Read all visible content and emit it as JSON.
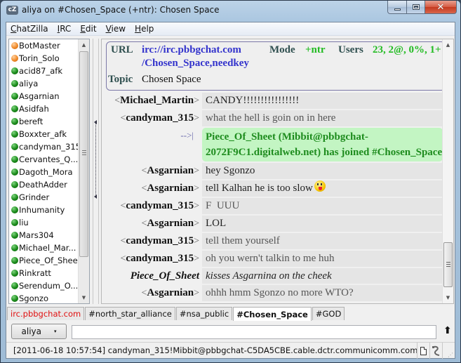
{
  "window": {
    "title": "aliya on #Chosen_Space (+ntr): Chosen Space",
    "app_icon": "cZ",
    "controls": {
      "minimize": "minimize",
      "maximize": "maximize",
      "close": "✕"
    }
  },
  "menubar": {
    "items": [
      {
        "label": "ChatZilla",
        "accel": "C",
        "rest": "hatZilla"
      },
      {
        "label": "IRC",
        "accel": "I",
        "rest": "RC"
      },
      {
        "label": "Edit",
        "accel": "E",
        "rest": "dit"
      },
      {
        "label": "View",
        "accel": "V",
        "rest": "iew"
      },
      {
        "label": "Help",
        "accel": "H",
        "rest": "elp"
      }
    ]
  },
  "userlist": {
    "users": [
      {
        "nick": "BotMaster",
        "status": "op"
      },
      {
        "nick": "Torin_Solo",
        "status": "op"
      },
      {
        "nick": "acid87_afk",
        "status": "normal"
      },
      {
        "nick": "aliya",
        "status": "normal"
      },
      {
        "nick": "Asgarnian",
        "status": "normal"
      },
      {
        "nick": "Asidfah",
        "status": "normal"
      },
      {
        "nick": "bereft",
        "status": "normal"
      },
      {
        "nick": "Boxxter_afk",
        "status": "normal"
      },
      {
        "nick": "candyman_315",
        "status": "normal"
      },
      {
        "nick": "Cervantes_Q...",
        "status": "normal"
      },
      {
        "nick": "Dagoth_Mora",
        "status": "normal"
      },
      {
        "nick": "DeathAdder",
        "status": "normal"
      },
      {
        "nick": "Grinder",
        "status": "normal"
      },
      {
        "nick": "Inhumanity",
        "status": "normal"
      },
      {
        "nick": "liu",
        "status": "normal"
      },
      {
        "nick": "Mars304",
        "status": "normal"
      },
      {
        "nick": "Michael_Mar...",
        "status": "normal"
      },
      {
        "nick": "Piece_Of_Sheet",
        "status": "normal"
      },
      {
        "nick": "Rinkratt",
        "status": "normal"
      },
      {
        "nick": "Serendum_O...",
        "status": "normal"
      },
      {
        "nick": "Sgonzo",
        "status": "normal"
      }
    ]
  },
  "channel_header": {
    "url_label": "URL",
    "url_line1": "irc://irc.pbbgchat.com",
    "url_line2": "/Chosen_Space,needkey",
    "mode_label": "Mode",
    "mode_value": "+ntr",
    "users_label": "Users",
    "users_value": "23, 2@, 0%, 1+",
    "topic_label": "Topic",
    "topic_value": "Chosen Space"
  },
  "messages": [
    {
      "type": "msg",
      "nick": "Michael_Martin",
      "text": "CANDY!!!!!!!!!!!!!!!!",
      "dark": true
    },
    {
      "type": "msg",
      "nick": "candyman_315",
      "text": "what the hell is goin on in here"
    },
    {
      "type": "join",
      "marker": "-->|",
      "text": "Piece_Of_Sheet (Mibbit@pbbgchat-2072F9C1.digitalweb.net) has joined #Chosen_Space"
    },
    {
      "type": "msg",
      "nick": "Asgarnian",
      "text": "hey Sgonzo",
      "dark": true
    },
    {
      "type": "msg",
      "nick": "Asgarnian",
      "text": "tell Kalhan he is too slow",
      "dark": true,
      "emoji": "tongue-out-smiley"
    },
    {
      "type": "msg",
      "nick": "candyman_315",
      "text": "F  UUU"
    },
    {
      "type": "msg",
      "nick": "Asgarnian",
      "text": "LOL",
      "dark": true
    },
    {
      "type": "msg",
      "nick": "candyman_315",
      "text": "tell them yourself"
    },
    {
      "type": "msg",
      "nick": "candyman_315",
      "text": "oh you wern't talkin to me huh"
    },
    {
      "type": "action",
      "nick": "Piece_Of_Sheet",
      "text": "kisses Asgarnina on the cheek"
    },
    {
      "type": "msg",
      "nick": "Asgarnian",
      "text": "ohhh hmm Sgonzo no more WTO?"
    }
  ],
  "tabs": [
    {
      "label": "irc.pbbgchat.com",
      "kind": "server"
    },
    {
      "label": "#north_star_alliance",
      "kind": "channel"
    },
    {
      "label": "#nsa_public",
      "kind": "channel"
    },
    {
      "label": "#Chosen_Space",
      "kind": "channel",
      "active": true
    },
    {
      "label": "#GOD",
      "kind": "channel"
    }
  ],
  "input": {
    "nick_button": "aliya",
    "caret": "▾",
    "value": "",
    "send_icon": "⬆"
  },
  "statusbar": {
    "text": "[2011-06-18 10:57:54] candyman_315!Mibbit@pbbgchat-C5DA5CBE.cable.dctr.communicomm.com",
    "icons": [
      "document-icon",
      "connection-plug-icon"
    ]
  },
  "scroll_symbols": {
    "up": "▲",
    "down": "▼"
  }
}
